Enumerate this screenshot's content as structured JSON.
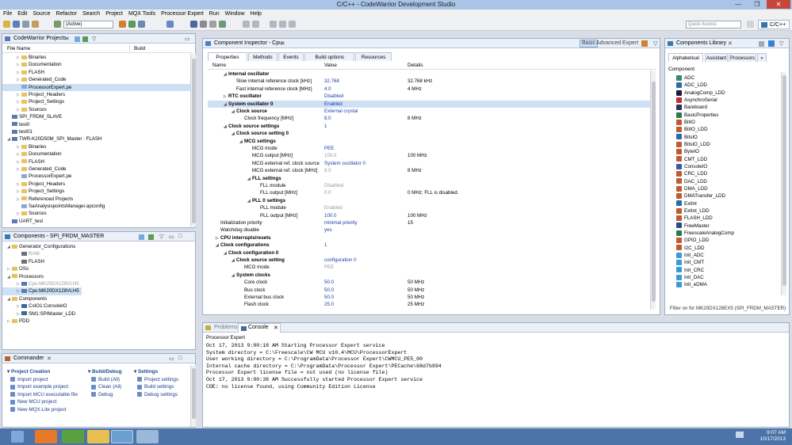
{
  "window": {
    "title": "C/C++ - CodeWarrior Development Studio",
    "min": "—",
    "max": "❐",
    "close": "✕"
  },
  "menu": [
    "File",
    "Edit",
    "Source",
    "Refactor",
    "Search",
    "Project",
    "MQX Tools",
    "Processor Expert",
    "Run",
    "Window",
    "Help"
  ],
  "toolbar": {
    "active_combo": "(Active)",
    "quick_access_placeholder": "Quick Access",
    "perspective_label": "C/C++"
  },
  "projects": {
    "title": "CodeWarrior Projects",
    "col_name": "File Name",
    "col_build": "Build",
    "rows": [
      {
        "level": 1,
        "twisty": "▷",
        "kind": "folder",
        "label": "Binaries"
      },
      {
        "level": 1,
        "twisty": "▷",
        "kind": "folder",
        "label": "Documentation"
      },
      {
        "level": 1,
        "twisty": "▷",
        "kind": "folder",
        "label": "FLASH"
      },
      {
        "level": 1,
        "twisty": "▷",
        "kind": "folder",
        "label": "Generated_Code"
      },
      {
        "level": 1,
        "twisty": "",
        "kind": "file",
        "label": "ProcessorExpert.pe",
        "selected": true
      },
      {
        "level": 1,
        "twisty": "▷",
        "kind": "folder",
        "label": "Project_Headers"
      },
      {
        "level": 1,
        "twisty": "▷",
        "kind": "folder",
        "label": "Project_Settings"
      },
      {
        "level": 1,
        "twisty": "▷",
        "kind": "folder",
        "label": "Sources"
      },
      {
        "level": 0,
        "twisty": "",
        "kind": "proj",
        "label": "SPI_FRDM_SLAVE"
      },
      {
        "level": 0,
        "twisty": "",
        "kind": "proj",
        "label": "test0"
      },
      {
        "level": 0,
        "twisty": "",
        "kind": "proj",
        "label": "test01"
      },
      {
        "level": 0,
        "twisty": "◢",
        "kind": "proj",
        "label": "TWR-K20D50M_SPI_Master : FLASH"
      },
      {
        "level": 1,
        "twisty": "▷",
        "kind": "folder",
        "label": "Binaries"
      },
      {
        "level": 1,
        "twisty": "▷",
        "kind": "folder",
        "label": "Documentation"
      },
      {
        "level": 1,
        "twisty": "▷",
        "kind": "folder",
        "label": "FLASH"
      },
      {
        "level": 1,
        "twisty": "▷",
        "kind": "folder",
        "label": "Generated_Code"
      },
      {
        "level": 1,
        "twisty": "",
        "kind": "file",
        "label": "ProcessorExpert.pe"
      },
      {
        "level": 1,
        "twisty": "▷",
        "kind": "folder",
        "label": "Project_Headers"
      },
      {
        "level": 1,
        "twisty": "▷",
        "kind": "folder",
        "label": "Project_Settings"
      },
      {
        "level": 1,
        "twisty": "▷",
        "kind": "folder",
        "label": "Referenced Projects"
      },
      {
        "level": 1,
        "twisty": "",
        "kind": "file",
        "label": "SaAnalysispointsManager.apconfig"
      },
      {
        "level": 1,
        "twisty": "▷",
        "kind": "folder",
        "label": "Sources"
      },
      {
        "level": 0,
        "twisty": "",
        "kind": "proj",
        "label": "UART_test"
      }
    ]
  },
  "components": {
    "title": "Components - SPI_FRDM_MASTER",
    "rows": [
      {
        "level": 0,
        "twisty": "◢",
        "kind": "folder",
        "label": "Generator_Configurations"
      },
      {
        "level": 1,
        "twisty": "",
        "kind": "gear",
        "label": "RAM",
        "gray": true
      },
      {
        "level": 1,
        "twisty": "",
        "kind": "gear",
        "label": "FLASH"
      },
      {
        "level": 0,
        "twisty": "▷",
        "kind": "folder",
        "label": "OSs"
      },
      {
        "level": 0,
        "twisty": "◢",
        "kind": "folder",
        "label": "Processors"
      },
      {
        "level": 1,
        "twisty": "▷",
        "kind": "cpu",
        "label": "Cpu:MK20DX128VLH5",
        "gray": true
      },
      {
        "level": 1,
        "twisty": "▷",
        "kind": "cpu",
        "label": "Cpu:MK20DX128VLH5",
        "selected": true
      },
      {
        "level": 0,
        "twisty": "◢",
        "kind": "folder",
        "label": "Components"
      },
      {
        "level": 1,
        "twisty": "▷",
        "kind": "comp",
        "label": "CsIO1:ConsoleIO"
      },
      {
        "level": 1,
        "twisty": "▷",
        "kind": "comp",
        "label": "SM1:SPIMaster_LDD"
      },
      {
        "level": 0,
        "twisty": "▷",
        "kind": "folder",
        "label": "PDD"
      }
    ]
  },
  "commander": {
    "title": "Commander",
    "sections": [
      {
        "title": "Project Creation",
        "items": [
          "Import project",
          "Import example project",
          "Import MCU executable file",
          "New MCU project",
          "New MQX-Lite project"
        ]
      },
      {
        "title": "Build/Debug",
        "items": [
          "Build  (All)",
          "Clean  (All)",
          "Debug"
        ]
      },
      {
        "title": "Settings",
        "items": [
          "Project settings",
          "Build settings",
          "Debug settings"
        ]
      }
    ]
  },
  "inspector": {
    "title": "Component Inspector - Cpu",
    "modes": [
      "Basic",
      "Advanced",
      "Expert"
    ],
    "tabs": [
      "Properties",
      "Methods",
      "Events",
      "Build options",
      "Resources"
    ],
    "headers": {
      "name": "Name",
      "value": "Value",
      "details": "Details"
    },
    "rows": [
      {
        "indent": 1,
        "tw": "◢",
        "bold": true,
        "name": "Internal oscillator",
        "value": "",
        "details": ""
      },
      {
        "indent": 2,
        "tw": "",
        "name": "Slow internal reference clock [kHz]",
        "value": "32.768",
        "details": "32.768 kHz",
        "vc": "blue"
      },
      {
        "indent": 2,
        "tw": "",
        "name": "Fast internal reference clock [MHz]",
        "value": "4.0",
        "details": "4 MHz",
        "vc": "blue"
      },
      {
        "indent": 1,
        "tw": "▷",
        "bold": true,
        "name": "RTC oscillator",
        "value": "Disabled",
        "details": "",
        "vc": "blue"
      },
      {
        "indent": 1,
        "tw": "◢",
        "bold": true,
        "name": "System oscillator 0",
        "value": "Enabled",
        "details": "",
        "vc": "blue",
        "hl": true
      },
      {
        "indent": 2,
        "tw": "◢",
        "bold": true,
        "name": "Clock source",
        "value": "External crystal",
        "details": "",
        "vc": "blue"
      },
      {
        "indent": 3,
        "tw": "",
        "name": "Clock frequency [MHz]",
        "value": "8.0",
        "details": "8 MHz",
        "vc": "blue"
      },
      {
        "indent": 1,
        "tw": "◢",
        "bold": true,
        "name": "Clock source settings",
        "value": "1",
        "details": "",
        "vc": "blue"
      },
      {
        "indent": 2,
        "tw": "◢",
        "bold": true,
        "name": "Clock source setting 0",
        "value": "",
        "details": ""
      },
      {
        "indent": 3,
        "tw": "◢",
        "bold": true,
        "name": "MCG settings",
        "value": "",
        "details": ""
      },
      {
        "indent": 4,
        "tw": "",
        "name": "MCG mode",
        "value": "PEE",
        "details": "",
        "vc": "blue"
      },
      {
        "indent": 4,
        "tw": "",
        "name": "MCG output [MHz]",
        "value": "100.0",
        "details": "100 MHz",
        "vc": "gray"
      },
      {
        "indent": 4,
        "tw": "",
        "name": "MCG external ref. clock source",
        "value": "System oscillator 0",
        "details": "",
        "vc": "blue"
      },
      {
        "indent": 4,
        "tw": "",
        "name": "MCG external ref. clock [MHz]",
        "value": "8.0",
        "details": "8 MHz",
        "vc": "gray"
      },
      {
        "indent": 4,
        "tw": "◢",
        "bold": true,
        "name": "FLL settings",
        "value": "",
        "details": ""
      },
      {
        "indent": 5,
        "tw": "",
        "name": "FLL module",
        "value": "Disabled",
        "details": "",
        "vc": "gray"
      },
      {
        "indent": 5,
        "tw": "",
        "name": "FLL output [MHz]",
        "value": "0.0",
        "details": "0 MHz; FLL is disabled.",
        "vc": "gray"
      },
      {
        "indent": 4,
        "tw": "◢",
        "bold": true,
        "name": "PLL 0 settings",
        "value": "",
        "details": ""
      },
      {
        "indent": 5,
        "tw": "",
        "name": "PLL module",
        "value": "Enabled",
        "details": "",
        "vc": "gray"
      },
      {
        "indent": 5,
        "tw": "",
        "name": "PLL output [MHz]",
        "value": "100.0",
        "details": "100 MHz",
        "vc": "blue"
      },
      {
        "indent": 0,
        "tw": "",
        "name": "Initialization priority",
        "value": "minimal priority",
        "details": "15",
        "vc": "blue"
      },
      {
        "indent": 0,
        "tw": "",
        "name": "Watchdog disable",
        "value": "yes",
        "details": "",
        "vc": "blue"
      },
      {
        "indent": 0,
        "tw": "▷",
        "bold": true,
        "name": "CPU interrupts/resets",
        "value": "",
        "details": ""
      },
      {
        "indent": 0,
        "tw": "◢",
        "bold": true,
        "name": "Clock configurations",
        "value": "1",
        "details": "",
        "vc": "blue"
      },
      {
        "indent": 1,
        "tw": "◢",
        "bold": true,
        "name": "Clock configuration 0",
        "value": "",
        "details": ""
      },
      {
        "indent": 2,
        "tw": "◢",
        "bold": true,
        "name": "Clock source setting",
        "value": "configuration 0",
        "details": "",
        "vc": "blue"
      },
      {
        "indent": 3,
        "tw": "",
        "name": "MCG mode",
        "value": "PEE",
        "details": "",
        "vc": "gray"
      },
      {
        "indent": 2,
        "tw": "◢",
        "bold": true,
        "name": "System clocks",
        "value": "",
        "details": ""
      },
      {
        "indent": 3,
        "tw": "",
        "name": "Core clock",
        "value": "50.0",
        "details": "50 MHz",
        "vc": "blue"
      },
      {
        "indent": 3,
        "tw": "",
        "name": "Bus clock",
        "value": "50.0",
        "details": "50 MHz",
        "vc": "blue"
      },
      {
        "indent": 3,
        "tw": "",
        "name": "External bus clock",
        "value": "50.0",
        "details": "50 MHz",
        "vc": "blue"
      },
      {
        "indent": 3,
        "tw": "",
        "name": "Flash clock",
        "value": "25.0",
        "details": "25 MHz",
        "vc": "blue"
      }
    ]
  },
  "library": {
    "title": "Components Library",
    "tabs": [
      "Alphabetical",
      "Assistant",
      "Processors",
      "»"
    ],
    "col": "Component",
    "items": [
      "ADC",
      "ADC_LDD",
      "AnalogComp_LDD",
      "AsynchroSerial",
      "Bareboard",
      "BasicProperties",
      "BitIO",
      "BitIO_LDD",
      "BitsIO",
      "BitsIO_LDD",
      "ByteIO",
      "CMT_LDD",
      "ConsoleIO",
      "CRC_LDD",
      "DAC_LDD",
      "DMA_LDD",
      "DMATransfer_LDD",
      "ExtInt",
      "ExtInt_LDD",
      "FLASH_LDD",
      "FreeMaster",
      "FreescaleAnalogComp",
      "GPIO_LDD",
      "I2C_LDD",
      "Init_ADC",
      "Init_CMT",
      "Init_CRC",
      "Init_DAC",
      "Init_eDMA"
    ],
    "filter": "Filter on for MK20DX128EX5 (SPI_FRDM_MASTER)"
  },
  "console": {
    "tabs": [
      "Problems",
      "Console"
    ],
    "header": "Processor Expert",
    "lines": [
      "Oct 17, 2013 9:00:18 AM Starting Processor Expert service",
      "System directory = C:\\Freescale\\CW MCU v10.4\\MCU\\ProcessorExpert",
      "User working directory = C:\\ProgramData\\Processor Expert\\CWMCU_PE5_00",
      "Internal cache directory = C:\\ProgramData\\Processor Expert\\PECache\\68d7b994",
      "Processor Expert license file = not used (no license file)",
      "Oct 17, 2013 9:00:38 AM Successfully started Processor Expert service",
      "CDE: no license found, using Community Edition License"
    ]
  },
  "taskbar": {
    "time": "9:07 AM",
    "date": "10/17/2013"
  }
}
